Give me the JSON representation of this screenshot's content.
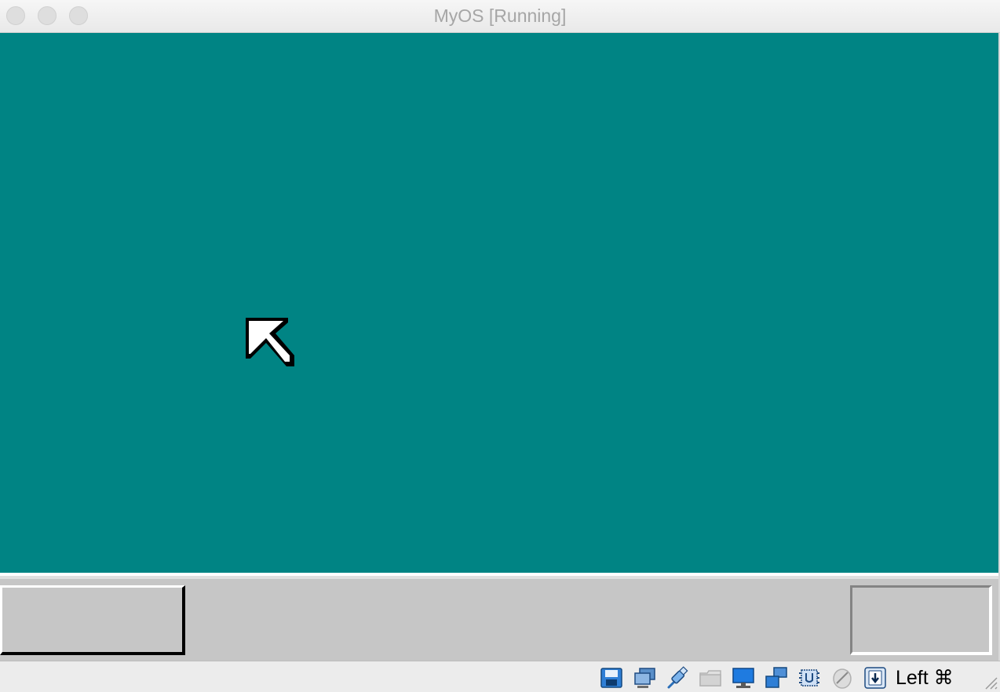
{
  "window": {
    "title": "MyOS [Running]"
  },
  "guest": {
    "desktop_color": "#008484",
    "taskbar_color": "#c6c6c6",
    "cursor_icon": "mouse-pointer-icon"
  },
  "statusbar": {
    "icons": [
      "hard-disk-icon",
      "optical-drive-icon",
      "usb-icon",
      "shared-folders-icon",
      "display-icon",
      "network-icon",
      "cpu-icon",
      "mouse-integration-icon",
      "keyboard-capture-icon"
    ],
    "host_key": "Left ⌘"
  }
}
